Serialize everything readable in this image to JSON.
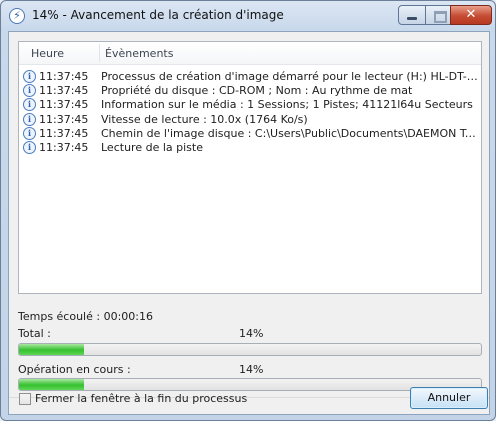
{
  "window": {
    "title": "14% - Avancement de la création d'image",
    "icon": "daemon-tools-icon"
  },
  "log": {
    "columns": [
      "Heure",
      "Évènements"
    ],
    "rows": [
      {
        "time": "11:37:45",
        "event": "Processus de création d'image démarré pour le lecteur (H:) HL-DT-ST DVDRAM ..."
      },
      {
        "time": "11:37:45",
        "event": "Propriété du disque : CD-ROM ; Nom : Au rythme de mat"
      },
      {
        "time": "11:37:45",
        "event": "Information sur le média : 1 Sessions; 1 Pistes; 41121l64u Secteurs"
      },
      {
        "time": "11:37:45",
        "event": "Vitesse de lecture : 10.0x (1764 Ko/s)"
      },
      {
        "time": "11:37:45",
        "event": "Chemin de l'image disque : C:\\Users\\Public\\Documents\\DAEMON Tools Images\\..."
      },
      {
        "time": "11:37:45",
        "event": "Lecture de la piste"
      }
    ]
  },
  "progress": {
    "elapsed": "Temps écoulé : 00:00:16",
    "total_label": "Total :",
    "total_percent": "14%",
    "total_value": 0.14,
    "current_label": "Opération en cours :",
    "current_percent": "14%",
    "current_value": 0.14
  },
  "footer": {
    "close_when_done": "Fermer la fenêtre à la fin du processus",
    "close_when_done_checked": false,
    "cancel_label": "Annuler"
  }
}
